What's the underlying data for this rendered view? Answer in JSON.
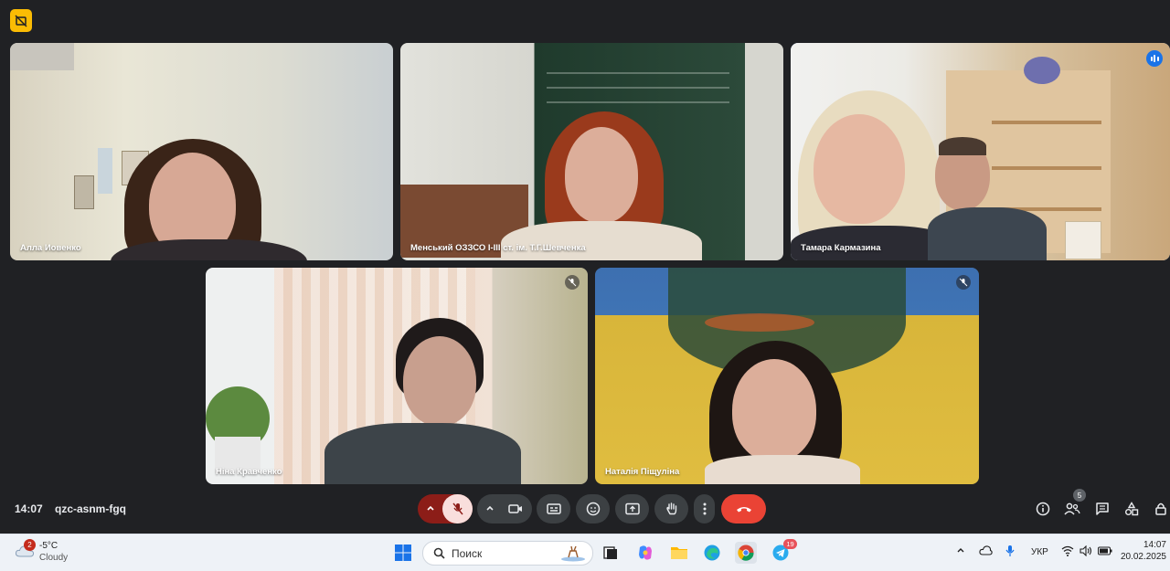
{
  "meeting": {
    "time": "14:07",
    "code": "qzc-asnm-fgq",
    "participants_count": "5"
  },
  "tiles": [
    {
      "name": "Алла Иовенко",
      "muted": false
    },
    {
      "name": "Менський ОЗЗСО І-ІІІ ст. ім. Т.Г.Шевченка",
      "muted": false
    },
    {
      "name": "Тамара Кармазина",
      "muted": false,
      "speaking": true
    },
    {
      "name": "Ніна Кравченко",
      "muted": true
    },
    {
      "name": "Наталія Піщуліна",
      "muted": true
    }
  ],
  "controls": {
    "mic": "mic-off",
    "camera": "camera",
    "captions": "captions",
    "reactions": "emoji",
    "present": "present",
    "raise_hand": "hand",
    "more": "more",
    "leave": "hang-up"
  },
  "taskbar": {
    "weather_temp": "-5°C",
    "weather_cond": "Cloudy",
    "weather_badge": "2",
    "search_placeholder": "Поиск",
    "telegram_badge": "19",
    "language": "УКР",
    "clock_time": "14:07",
    "clock_date": "20.02.2025"
  },
  "colors": {
    "meet_bg": "#202124",
    "active_outline": "#8ab4f8",
    "leave_red": "#ea4335",
    "mic_off_bg": "#f9dedc"
  }
}
